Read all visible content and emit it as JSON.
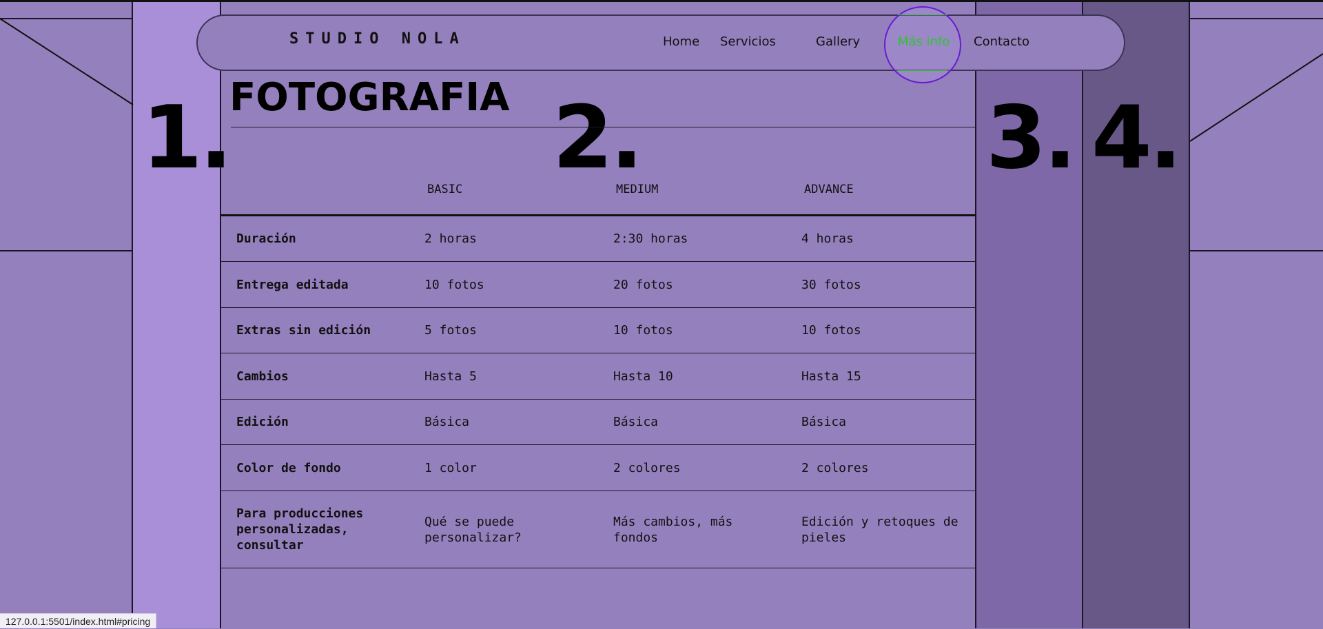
{
  "nav": {
    "brand": "STUDIO NOLA",
    "links": [
      {
        "label": "Home"
      },
      {
        "label": "Servicios"
      },
      {
        "label": "Gallery"
      },
      {
        "label": "Más info",
        "hover": true
      },
      {
        "label": "Contacto"
      }
    ]
  },
  "section_numbers": [
    "1.",
    "2.",
    "3.",
    "4."
  ],
  "page_title": "FOTOGRAFIA",
  "pricing": {
    "plans": [
      "BASIC",
      "MEDIUM",
      "ADVANCE"
    ],
    "rows": [
      {
        "label": "Duración",
        "values": [
          "2 horas",
          "2:30 horas",
          "4 horas"
        ]
      },
      {
        "label": "Entrega editada",
        "values": [
          "10 fotos",
          "20 fotos",
          "30 fotos"
        ]
      },
      {
        "label": "Extras sin edición",
        "values": [
          "5 fotos",
          "10 fotos",
          "10 fotos"
        ]
      },
      {
        "label": "Cambios",
        "values": [
          "Hasta 5",
          "Hasta 10",
          "Hasta 15"
        ]
      },
      {
        "label": "Edición",
        "values": [
          "Básica",
          "Básica",
          "Básica"
        ]
      },
      {
        "label": "Color de fondo",
        "values": [
          "1 color",
          "2 colores",
          "2 colores"
        ]
      },
      {
        "label": "Para producciones personalizadas, consultar",
        "values": [
          "Qué se puede personalizar?",
          "Más cambios, más fondos",
          "Edición y retoques de pieles"
        ]
      }
    ]
  },
  "status_url": "127.0.0.1:5501/index.html#pricing",
  "colors": {
    "background": "#9580be",
    "column_1": "#a98ed8",
    "column_3": "#7f68a8",
    "column_4": "#685888",
    "hover_link": "#2ec52e",
    "hover_ring": "#6a1bd2"
  }
}
